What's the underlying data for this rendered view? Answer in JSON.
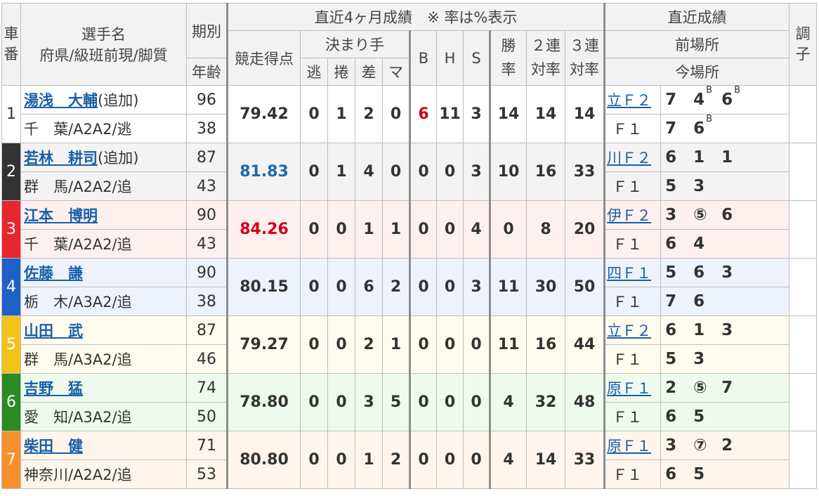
{
  "header": {
    "car_no": "車番",
    "name": "選手名",
    "name_sub": "府県/級班前現/脚質",
    "period": "期別",
    "age": "年齢",
    "recent4": "直近4ヶ月成績　※ 率は%表示",
    "score": "競走得点",
    "kimarite": "決まり手",
    "nige": "逃",
    "makuri": "捲",
    "sashi": "差",
    "mark": "マ",
    "b": "B",
    "h": "H",
    "s": "S",
    "win_rate": "勝率",
    "rate2": "２連対率",
    "rate3": "３連対率",
    "recent_results": "直近成績",
    "prev_venue": "前場所",
    "this_venue": "今場所",
    "condition": "調子"
  },
  "colors": {
    "car1": "#ffffff",
    "car2": "#333333",
    "car3": "#e8262f",
    "car4": "#1e61c6",
    "car5": "#f2c21b",
    "car6": "#2a8a24",
    "car7": "#f5902d",
    "row1": "#ffffff",
    "row2": "#f3f3f3",
    "row3": "#fff0f0",
    "row4": "#eef3fb",
    "row5": "#fffbee",
    "row6": "#eefaee",
    "row7": "#fff5ec"
  },
  "riders": [
    {
      "no": "1",
      "name": "湯浅　大輔",
      "tag": "(追加)",
      "pref": "千　葉/A2A2/逃",
      "period": "96",
      "age": "38",
      "score": "79.42",
      "nige": "0",
      "makuri": "1",
      "sashi": "2",
      "mark": "0",
      "b": "6",
      "h": "11",
      "s": "3",
      "win": "14",
      "r2": "14",
      "r3": "14",
      "prev_venue": "立Ｆ２",
      "prev_results": [
        "7",
        "4",
        "6"
      ],
      "prev_sups": [
        "",
        "B",
        "B"
      ],
      "this_venue": "Ｆ１",
      "this_results": [
        "7",
        "6"
      ],
      "this_sups": [
        "",
        "B"
      ]
    },
    {
      "no": "2",
      "name": "若林　耕司",
      "tag": "(追加)",
      "pref": "群　馬/A2A2/追",
      "period": "87",
      "age": "43",
      "score": "81.83",
      "nige": "0",
      "makuri": "1",
      "sashi": "4",
      "mark": "0",
      "b": "0",
      "h": "0",
      "s": "3",
      "win": "10",
      "r2": "16",
      "r3": "33",
      "prev_venue": "川Ｆ２",
      "prev_results": [
        "6",
        "1",
        "1"
      ],
      "prev_sups": [
        "",
        "",
        ""
      ],
      "this_venue": "Ｆ１",
      "this_results": [
        "5",
        "3"
      ],
      "this_sups": [
        "",
        ""
      ]
    },
    {
      "no": "3",
      "name": "江本　博明",
      "tag": "",
      "pref": "千　葉/A2A2/追",
      "period": "90",
      "age": "43",
      "score": "84.26",
      "nige": "0",
      "makuri": "0",
      "sashi": "1",
      "mark": "1",
      "b": "0",
      "h": "0",
      "s": "4",
      "win": "0",
      "r2": "8",
      "r3": "20",
      "prev_venue": "伊Ｆ２",
      "prev_results": [
        "3",
        "⑤",
        "6"
      ],
      "prev_sups": [
        "",
        "",
        ""
      ],
      "this_venue": "Ｆ１",
      "this_results": [
        "6",
        "4"
      ],
      "this_sups": [
        "",
        ""
      ]
    },
    {
      "no": "4",
      "name": "佐藤　謙",
      "tag": "",
      "pref": "栃　木/A3A2/追",
      "period": "90",
      "age": "38",
      "score": "80.15",
      "nige": "0",
      "makuri": "0",
      "sashi": "6",
      "mark": "2",
      "b": "0",
      "h": "0",
      "s": "3",
      "win": "11",
      "r2": "30",
      "r3": "50",
      "prev_venue": "四Ｆ１",
      "prev_results": [
        "5",
        "6",
        "3"
      ],
      "prev_sups": [
        "",
        "",
        ""
      ],
      "this_venue": "Ｆ１",
      "this_results": [
        "7",
        "6"
      ],
      "this_sups": [
        "",
        ""
      ]
    },
    {
      "no": "5",
      "name": "山田　武",
      "tag": "",
      "pref": "群　馬/A3A2/追",
      "period": "87",
      "age": "46",
      "score": "79.27",
      "nige": "0",
      "makuri": "0",
      "sashi": "2",
      "mark": "1",
      "b": "0",
      "h": "0",
      "s": "0",
      "win": "11",
      "r2": "16",
      "r3": "44",
      "prev_venue": "立Ｆ２",
      "prev_results": [
        "6",
        "1",
        "3"
      ],
      "prev_sups": [
        "",
        "",
        ""
      ],
      "this_venue": "Ｆ１",
      "this_results": [
        "5",
        "3"
      ],
      "this_sups": [
        "",
        ""
      ]
    },
    {
      "no": "6",
      "name": "吉野　猛",
      "tag": "",
      "pref": "愛　知/A3A2/追",
      "period": "74",
      "age": "50",
      "score": "78.80",
      "nige": "0",
      "makuri": "0",
      "sashi": "3",
      "mark": "5",
      "b": "0",
      "h": "0",
      "s": "0",
      "win": "4",
      "r2": "32",
      "r3": "48",
      "prev_venue": "原Ｆ１",
      "prev_results": [
        "2",
        "⑤",
        "7"
      ],
      "prev_sups": [
        "",
        "",
        ""
      ],
      "this_venue": "Ｆ１",
      "this_results": [
        "6",
        "5"
      ],
      "this_sups": [
        "",
        ""
      ]
    },
    {
      "no": "7",
      "name": "柴田　健",
      "tag": "",
      "pref": "神奈川/A2A2/追",
      "period": "71",
      "age": "53",
      "score": "80.80",
      "nige": "0",
      "makuri": "0",
      "sashi": "1",
      "mark": "2",
      "b": "0",
      "h": "0",
      "s": "0",
      "win": "4",
      "r2": "14",
      "r3": "33",
      "prev_venue": "原Ｆ１",
      "prev_results": [
        "3",
        "⑦",
        "2"
      ],
      "prev_sups": [
        "",
        "",
        ""
      ],
      "this_venue": "Ｆ１",
      "this_results": [
        "6",
        "5"
      ],
      "this_sups": [
        "",
        ""
      ]
    }
  ]
}
